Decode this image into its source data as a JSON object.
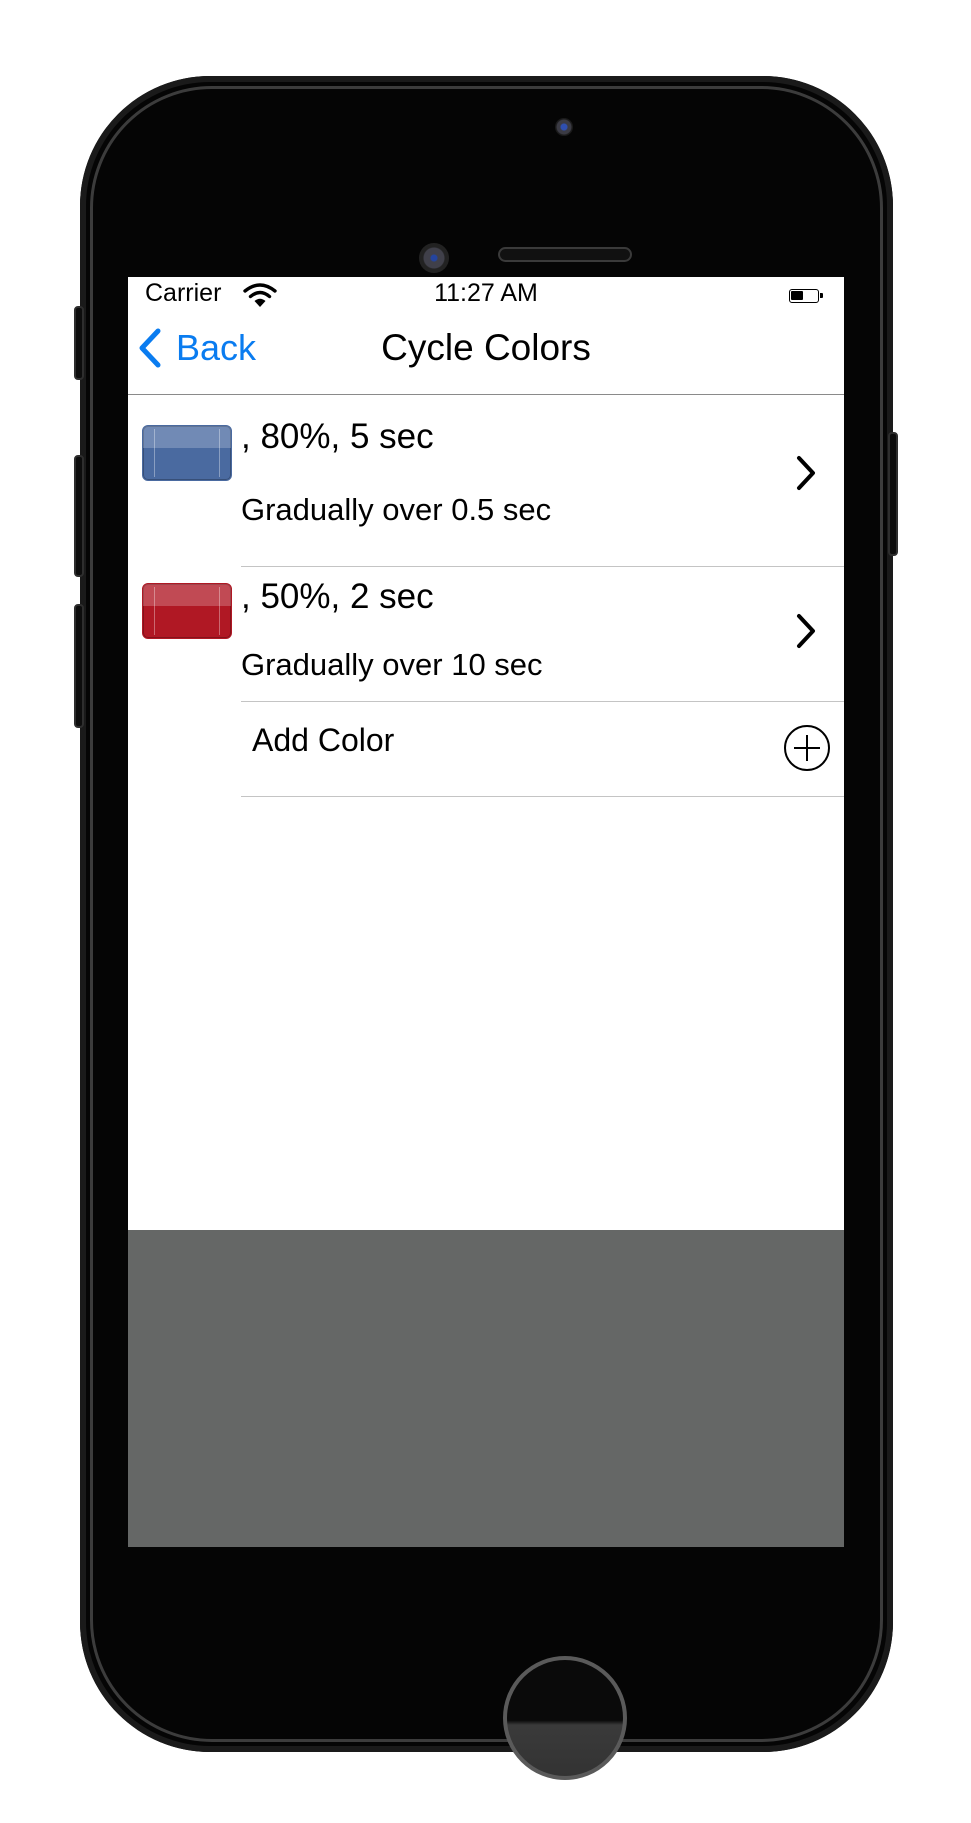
{
  "status_bar": {
    "carrier": "Carrier",
    "time": "11:27 AM",
    "battery_level": 0.45
  },
  "nav": {
    "back_label": "Back",
    "title": "Cycle Colors"
  },
  "colors": [
    {
      "swatch_color": "#4a6aa0",
      "title": ", 80%, 5 sec",
      "subtitle": "Gradually over 0.5 sec"
    },
    {
      "swatch_color": "#b01824",
      "title": ", 50%, 2 sec",
      "subtitle": "Gradually over 10 sec"
    }
  ],
  "add_color": {
    "label": "Add Color"
  },
  "theme": {
    "accent": "#0a7cf0",
    "bottom_panel": "#656766"
  }
}
